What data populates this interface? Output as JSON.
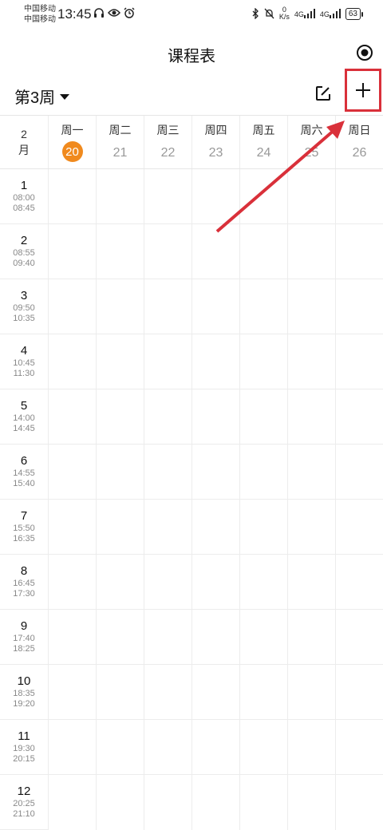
{
  "status": {
    "carrier1": "中国移动",
    "carrier2": "中国移动",
    "time": "13:45",
    "speed_value": "0",
    "speed_unit": "K/s",
    "net1": "4G",
    "net2": "4G",
    "battery": "63"
  },
  "app": {
    "title": "课程表",
    "week_selector": "第3周"
  },
  "calendar": {
    "month_num": "2",
    "month_unit": "月",
    "days": [
      {
        "name": "周一",
        "date": "20",
        "today": true
      },
      {
        "name": "周二",
        "date": "21",
        "today": false
      },
      {
        "name": "周三",
        "date": "22",
        "today": false
      },
      {
        "name": "周四",
        "date": "23",
        "today": false
      },
      {
        "name": "周五",
        "date": "24",
        "today": false
      },
      {
        "name": "周六",
        "date": "25",
        "today": false
      },
      {
        "name": "周日",
        "date": "26",
        "today": false
      }
    ],
    "periods": [
      {
        "num": "1",
        "start": "08:00",
        "end": "08:45"
      },
      {
        "num": "2",
        "start": "08:55",
        "end": "09:40"
      },
      {
        "num": "3",
        "start": "09:50",
        "end": "10:35"
      },
      {
        "num": "4",
        "start": "10:45",
        "end": "11:30"
      },
      {
        "num": "5",
        "start": "14:00",
        "end": "14:45"
      },
      {
        "num": "6",
        "start": "14:55",
        "end": "15:40"
      },
      {
        "num": "7",
        "start": "15:50",
        "end": "16:35"
      },
      {
        "num": "8",
        "start": "16:45",
        "end": "17:30"
      },
      {
        "num": "9",
        "start": "17:40",
        "end": "18:25"
      },
      {
        "num": "10",
        "start": "18:35",
        "end": "19:20"
      },
      {
        "num": "11",
        "start": "19:30",
        "end": "20:15"
      },
      {
        "num": "12",
        "start": "20:25",
        "end": "21:10"
      }
    ]
  },
  "colors": {
    "today": "#f08a1e",
    "highlight": "#d9303a"
  }
}
